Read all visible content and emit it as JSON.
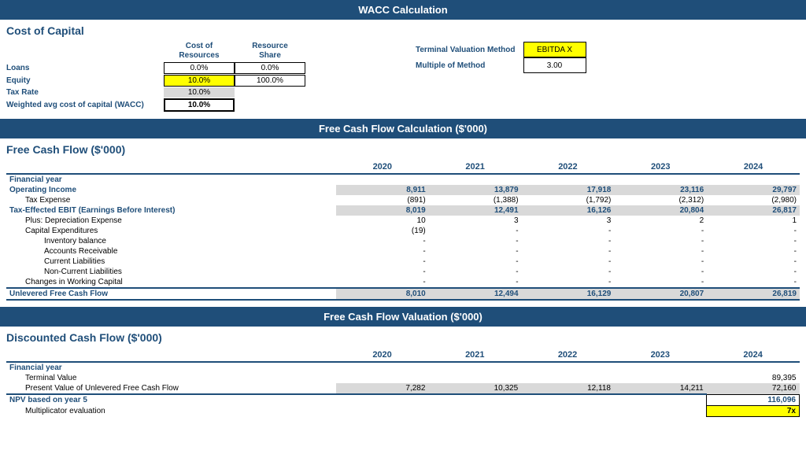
{
  "title": "WACC Calculation",
  "wacc": {
    "section_title": "Cost of Capital",
    "col_headers": [
      "Cost of Resources",
      "Resource Share"
    ],
    "rows": [
      {
        "label": "Loans",
        "cost": "0.0%",
        "share": "0.0%",
        "cost_style": "outlined",
        "share_style": "outlined"
      },
      {
        "label": "Equity",
        "cost": "10.0%",
        "share": "100.0%",
        "cost_style": "yellow",
        "share_style": "outlined"
      },
      {
        "label": "Tax Rate",
        "cost": "10.0%",
        "share": "",
        "cost_style": "gray",
        "share_style": ""
      },
      {
        "label": "Weighted avg cost of capital (WACC)",
        "cost": "10.0%",
        "share": "",
        "cost_style": "bold-border",
        "share_style": ""
      }
    ],
    "right": {
      "labels": [
        "Terminal Valuation Method",
        "Multiple of Method"
      ],
      "values": [
        {
          "text": "EBITDA X",
          "style": "yellow"
        },
        {
          "text": "3.00",
          "style": "outlined"
        }
      ]
    }
  },
  "fcf": {
    "section_header": "Free Cash Flow Calculation ($'000)",
    "section_title": "Free Cash Flow ($'000)",
    "years": [
      "2020",
      "2021",
      "2022",
      "2023",
      "2024"
    ],
    "rows": [
      {
        "type": "header",
        "label": "Financial year"
      },
      {
        "type": "main",
        "label": "Operating Income",
        "values": [
          "8,911",
          "13,879",
          "17,918",
          "23,116",
          "29,797"
        ],
        "bg": "gray"
      },
      {
        "type": "sub",
        "label": "Tax Expense",
        "values": [
          "(891)",
          "(1,388)",
          "(1,792)",
          "(2,312)",
          "(2,980)"
        ],
        "bg": "white"
      },
      {
        "type": "main",
        "label": "Tax-Effected EBIT (Earnings Before Interest)",
        "values": [
          "8,019",
          "12,491",
          "16,126",
          "20,804",
          "26,817"
        ],
        "bg": "gray"
      },
      {
        "type": "sub",
        "label": "Plus: Depreciation Expense",
        "values": [
          "10",
          "3",
          "3",
          "2",
          "1"
        ],
        "bg": "white"
      },
      {
        "type": "sub",
        "label": "Capital Expenditures",
        "values": [
          "(19)",
          "-",
          "-",
          "-",
          "-"
        ],
        "bg": "white"
      },
      {
        "type": "subsub",
        "label": "Inventory balance",
        "values": [
          "-",
          "-",
          "-",
          "-",
          "-"
        ],
        "bg": "white"
      },
      {
        "type": "subsub",
        "label": "Accounts Receivable",
        "values": [
          "-",
          "-",
          "-",
          "-",
          "-"
        ],
        "bg": "white"
      },
      {
        "type": "subsub",
        "label": "Current Liabilities",
        "values": [
          "-",
          "-",
          "-",
          "-",
          "-"
        ],
        "bg": "white"
      },
      {
        "type": "subsub",
        "label": "Non-Current Liabilities",
        "values": [
          "-",
          "-",
          "-",
          "-",
          "-"
        ],
        "bg": "white"
      },
      {
        "type": "sub",
        "label": "Changes in Working Capital",
        "values": [
          "-",
          "-",
          "-",
          "-",
          "-"
        ],
        "bg": "white"
      },
      {
        "type": "total",
        "label": "Unlevered Free Cash Flow",
        "values": [
          "8,010",
          "12,494",
          "16,129",
          "20,807",
          "26,819"
        ],
        "bg": "gray"
      }
    ]
  },
  "valuation": {
    "section_header": "Free Cash Flow Valuation ($'000)",
    "section_title": "Discounted Cash Flow ($'000)",
    "years": [
      "2020",
      "2021",
      "2022",
      "2023",
      "2024"
    ],
    "rows": [
      {
        "type": "header",
        "label": "Financial year"
      },
      {
        "type": "sub",
        "label": "Terminal Value",
        "values": [
          "",
          "",
          "",
          "",
          "89,395"
        ],
        "bg": "white"
      },
      {
        "type": "sub",
        "label": "Present Value of Unlevered Free Cash Flow",
        "values": [
          "7,282",
          "10,325",
          "12,118",
          "14,211",
          "72,160"
        ],
        "bg": "gray"
      },
      {
        "type": "npv",
        "label": "NPV based on year 5",
        "values": [
          "",
          "",
          "",
          "",
          "116,096"
        ],
        "bg": "white"
      },
      {
        "type": "sub",
        "label": "Multiplicator evaluation",
        "values": [
          "",
          "",
          "",
          "",
          "7x"
        ],
        "bg": "white",
        "last_style": "yellow"
      }
    ]
  }
}
